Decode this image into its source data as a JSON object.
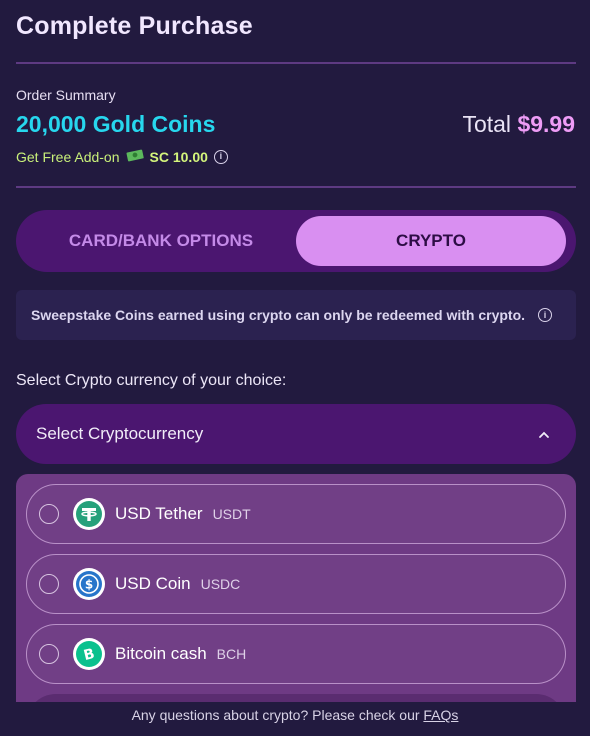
{
  "header": {
    "title": "Complete Purchase"
  },
  "summary": {
    "label": "Order Summary",
    "product": "20,000 Gold Coins",
    "total_label": "Total",
    "total_amount": "$9.99",
    "addon_label": "Get Free Add-on",
    "addon_value": "SC 10.00"
  },
  "tabs": [
    {
      "label": "CARD/BANK OPTIONS",
      "active": false
    },
    {
      "label": "CRYPTO",
      "active": true
    }
  ],
  "notice": {
    "text": "Sweepstake Coins earned using crypto can only be redeemed with crypto."
  },
  "crypto": {
    "prompt": "Select Crypto currency of your choice:",
    "select_placeholder": "Select Cryptocurrency",
    "options": [
      {
        "name": "USD Tether",
        "code": "USDT",
        "icon": "tether-icon",
        "color": "#26a17b"
      },
      {
        "name": "USD Coin",
        "code": "USDC",
        "icon": "usdc-icon",
        "color": "#2775ca"
      },
      {
        "name": "Bitcoin cash",
        "code": "BCH",
        "icon": "bitcoin-cash-icon",
        "color": "#0ac18e"
      }
    ]
  },
  "footer": {
    "text": "Any questions about crypto? Please check our",
    "link": "FAQs"
  },
  "colors": {
    "background": "#221a3f",
    "accent_cyan": "#27d7ee",
    "accent_pink": "#ee9cf6",
    "addon_green": "#c9f07a",
    "active_tab": "#d98ff1"
  }
}
